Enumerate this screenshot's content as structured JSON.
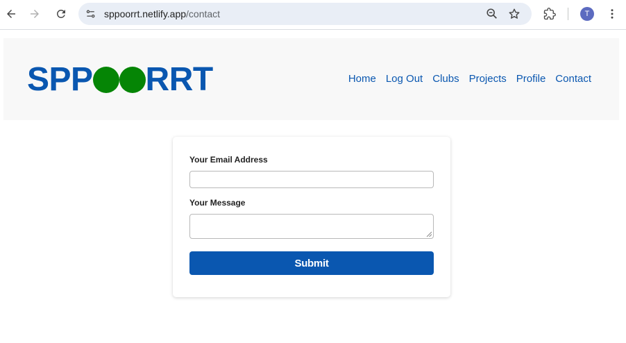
{
  "browser": {
    "url_host": "sppoorrt.netlify.app",
    "url_path": "/contact",
    "profile_initial": "T",
    "icons": [
      "back-arrow-icon",
      "forward-arrow-icon",
      "reload-icon",
      "site-info-icon",
      "zoom-icon",
      "bookmark-star-icon",
      "extensions-icon",
      "more-vert-icon"
    ]
  },
  "site": {
    "logo_left": "SPP",
    "logo_right": "RRT",
    "nav": [
      "Home",
      "Log Out",
      "Clubs",
      "Projects",
      "Profile",
      "Contact"
    ]
  },
  "form": {
    "email_label": "Your Email Address",
    "email_value": "",
    "message_label": "Your Message",
    "message_value": "",
    "submit_label": "Submit"
  },
  "colors": {
    "brand_blue": "#0a57b0",
    "logo_green": "#058505",
    "header_bg": "#f8f8f8"
  }
}
